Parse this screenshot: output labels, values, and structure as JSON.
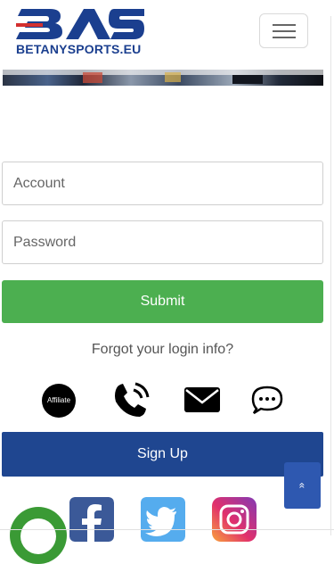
{
  "brand": {
    "logo_text": "BETANYSPORTS.EU",
    "logo_mark_text": "BAS",
    "primary_color": "#1b3f8f"
  },
  "nav": {
    "menu_icon": "hamburger-icon"
  },
  "login": {
    "account_placeholder": "Account",
    "password_placeholder": "Password",
    "submit_label": "Submit",
    "submit_color": "#4caf50",
    "forgot_text": "Forgot your login info?"
  },
  "contact": {
    "affiliate_label": "Affiliate",
    "icons": [
      "affiliate-icon",
      "phone-icon",
      "mail-icon",
      "chat-icon"
    ]
  },
  "signup": {
    "label": "Sign Up",
    "color": "#1f4690"
  },
  "scroll_top": {
    "icon": "chevron-double-up-icon",
    "glyph": "«"
  },
  "social": {
    "icons": [
      "facebook-icon",
      "twitter-icon",
      "instagram-icon"
    ]
  },
  "chat_widget": {
    "icon": "live-chat-icon"
  }
}
